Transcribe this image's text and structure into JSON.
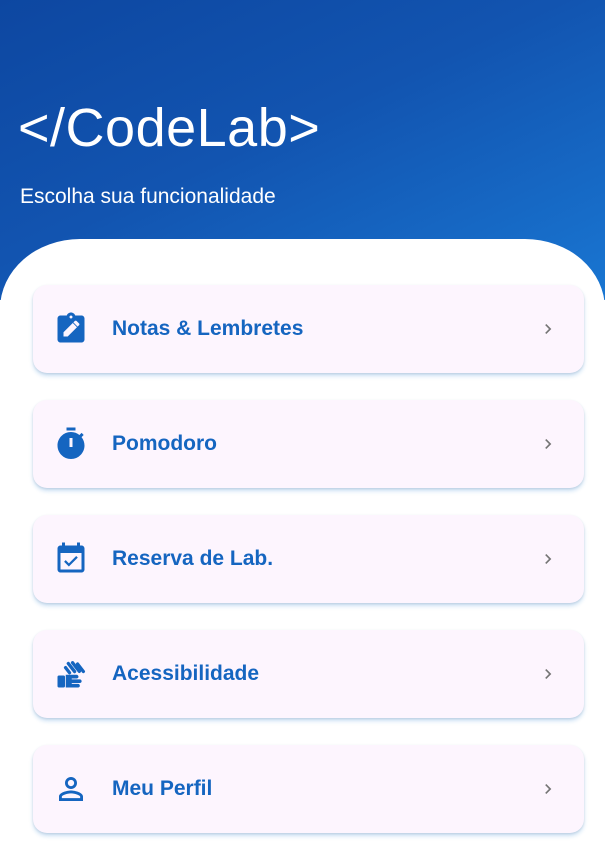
{
  "header": {
    "title": "</CodeLab>",
    "subtitle": "Escolha sua funcionalidade"
  },
  "menu": {
    "items": [
      {
        "label": "Notas & Lembretes",
        "icon": "assignment-edit-icon"
      },
      {
        "label": "Pomodoro",
        "icon": "timer-icon"
      },
      {
        "label": "Reserva de Lab.",
        "icon": "event-available-icon"
      },
      {
        "label": "Acessibilidade",
        "icon": "sign-language-icon"
      },
      {
        "label": "Meu Perfil",
        "icon": "person-icon"
      }
    ]
  },
  "colors": {
    "accent": "#1565c0",
    "header_gradient_start": "#0d47a1",
    "header_gradient_end": "#1976d2",
    "card_background": "#fdf5fe",
    "chevron": "#757575"
  }
}
